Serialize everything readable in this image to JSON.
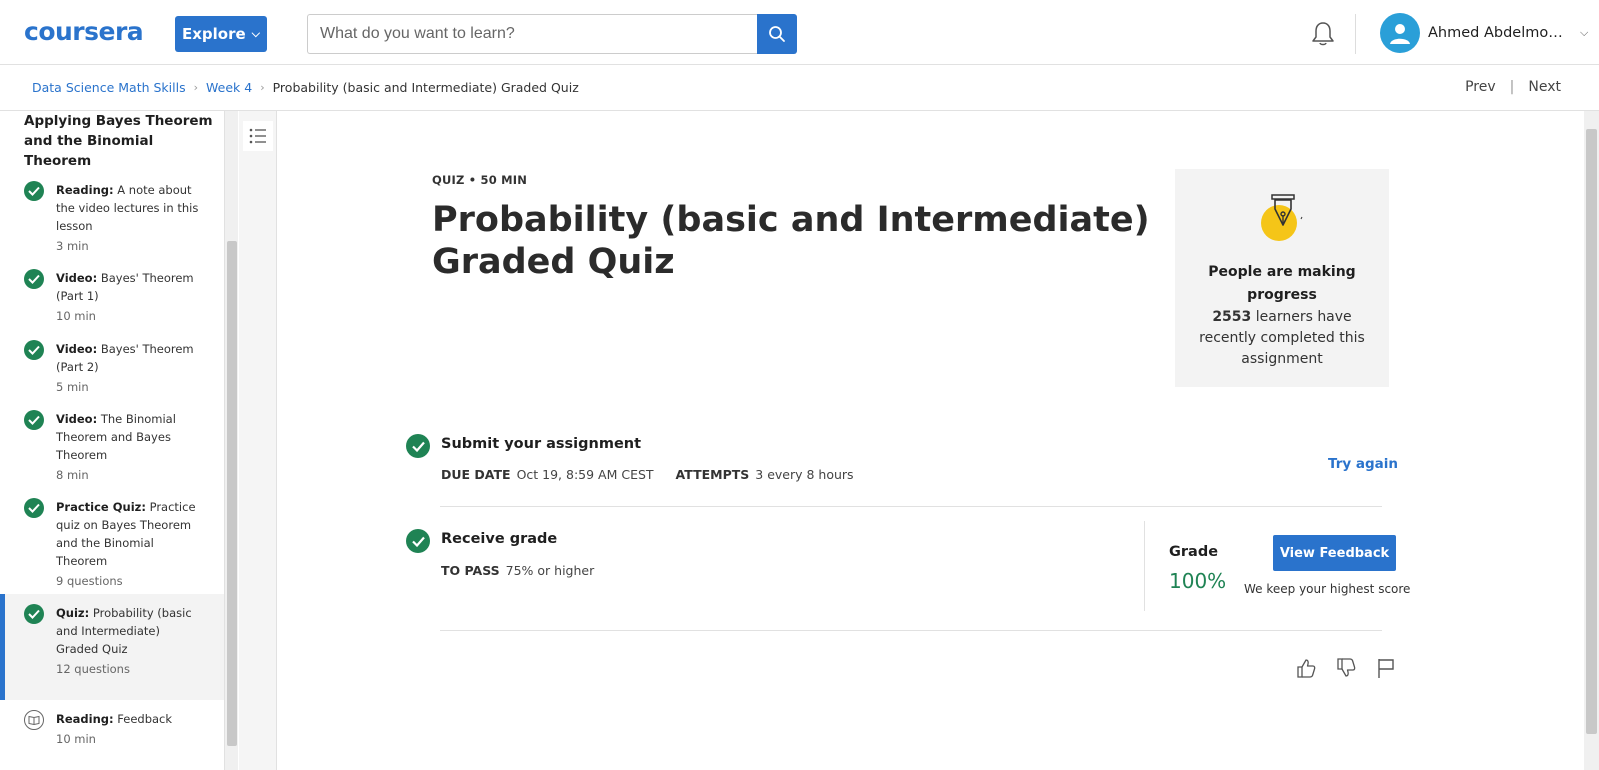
{
  "header": {
    "logo": "coursera",
    "explore_label": "Explore",
    "search_placeholder": "What do you want to learn?",
    "user_name": "Ahmed Abdelmotel..."
  },
  "breadcrumb": {
    "items": [
      "Data Science Math Skills",
      "Week 4",
      "Probability (basic and Intermediate) Graded Quiz"
    ],
    "prev": "Prev",
    "next": "Next"
  },
  "sidebar": {
    "title": "Applying Bayes Theorem and the Binomial Theorem",
    "items": [
      {
        "type": "Reading:",
        "name": "A note about the video lectures in this lesson",
        "meta": "3 min"
      },
      {
        "type": "Video:",
        "name": "Bayes' Theorem (Part 1)",
        "meta": "10 min"
      },
      {
        "type": "Video:",
        "name": "Bayes' Theorem (Part 2)",
        "meta": "5 min"
      },
      {
        "type": "Video:",
        "name": "The Binomial Theorem and Bayes Theorem",
        "meta": "8 min"
      },
      {
        "type": "Practice Quiz:",
        "name": "Practice quiz on Bayes Theorem and the Binomial Theorem",
        "meta": "9 questions"
      },
      {
        "type": "Quiz:",
        "name": "Probability (basic and Intermediate) Graded Quiz",
        "meta": "12 questions"
      },
      {
        "type": "Reading:",
        "name": "Feedback",
        "meta": "10 min"
      }
    ]
  },
  "quiz": {
    "meta": "QUIZ • 50 MIN",
    "title": "Probability (basic and Intermediate) Graded Quiz"
  },
  "progress_card": {
    "title": "People are making progress",
    "count": "2553",
    "text": "learners have recently completed this assignment"
  },
  "submit": {
    "heading": "Submit your assignment",
    "due_label": "DUE DATE",
    "due_value": "Oct 19, 8:59 AM CEST",
    "attempts_label": "ATTEMPTS",
    "attempts_value": "3 every 8 hours",
    "try_again": "Try again"
  },
  "grade": {
    "heading": "Receive grade",
    "pass_label": "TO PASS",
    "pass_value": "75% or higher",
    "grade_label": "Grade",
    "grade_value": "100%",
    "view_feedback": "View Feedback",
    "keep_note": "We keep your highest score"
  },
  "colors": {
    "brand": "#2a73cc",
    "success": "#1f8354",
    "card_bg": "#f3f3f3"
  }
}
